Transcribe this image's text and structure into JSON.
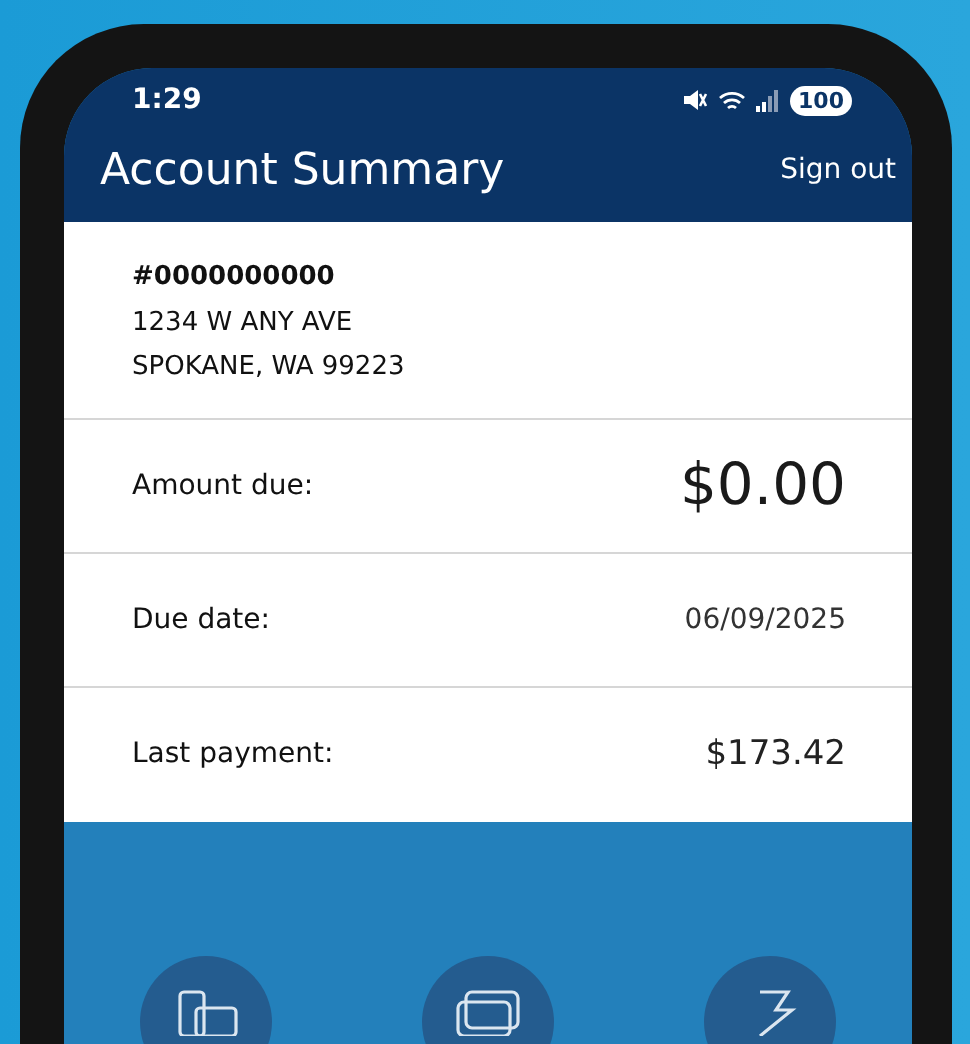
{
  "status_bar": {
    "time": "1:29",
    "battery": "100"
  },
  "header": {
    "title": "Account Summary",
    "action": "Sign out"
  },
  "account": {
    "number": "#0000000000",
    "address_lines": [
      "1234 W ANY AVE",
      "SPOKANE, WA 99223"
    ]
  },
  "rows": [
    {
      "label": "Amount due:",
      "value": "$0.00",
      "kind": "large"
    },
    {
      "label": "Due date:",
      "value": "06/09/2025",
      "kind": "small"
    },
    {
      "label": "Last payment:",
      "value": "$173.42",
      "kind": "normal"
    }
  ],
  "actions": [
    {
      "kind": "devices"
    },
    {
      "kind": "card"
    },
    {
      "kind": "bolt"
    }
  ]
}
